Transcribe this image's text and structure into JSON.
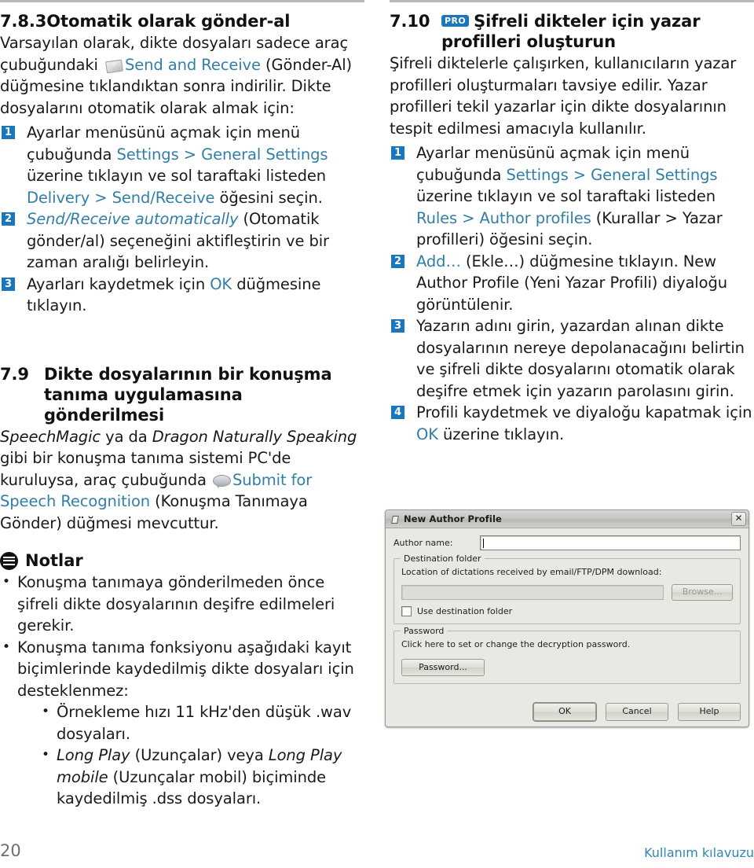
{
  "page": {
    "number": "20",
    "doc_label": "Kullanım kılavuzu"
  },
  "left_column": {
    "section": {
      "number": "7.8.3",
      "title": "Otomatik olarak gönder-al"
    },
    "intro": {
      "part1": "Varsayılan olarak, dikte dosyaları sadece araç çubuğundaki ",
      "icon": "send-receive-envelope-icon",
      "link": "Send and Receive",
      "part2": " (Gönder-Al) düğmesine tıklandıktan sonra indirilir. Dikte dosyalarını otomatik olarak almak için:"
    },
    "steps": [
      {
        "num": "1",
        "parts": [
          {
            "t": "Ayarlar menüsünü açmak için menü çubuğunda ",
            "s": "plain"
          },
          {
            "t": "Settings > General Settings",
            "s": "link"
          },
          {
            "t": " üzerine tıklayın ve sol taraftaki listeden ",
            "s": "plain"
          },
          {
            "t": "Delivery > Send/Receive",
            "s": "link"
          },
          {
            "t": " öğesini seçin.",
            "s": "plain"
          }
        ]
      },
      {
        "num": "2",
        "parts": [
          {
            "t": "Send/Receive automatically",
            "s": "link-italic"
          },
          {
            "t": " (Otomatik gönder/al) seçeneğini aktifleştirin ve bir zaman aralığı belirleyin.",
            "s": "plain"
          }
        ]
      },
      {
        "num": "3",
        "parts": [
          {
            "t": "Ayarları kaydetmek için ",
            "s": "plain"
          },
          {
            "t": "OK",
            "s": "link"
          },
          {
            "t": " düğmesine tıklayın.",
            "s": "plain"
          }
        ]
      }
    ],
    "section2": {
      "number": "7.9",
      "title": "Dikte dosyalarının bir konuşma tanıma uygulamasına gönderilmesi"
    },
    "para2": {
      "a": "SpeechMagic",
      "b": " ya da ",
      "c": "Dragon Naturally Speaking",
      "d": " gibi bir konuşma tanıma sistemi PC'de kuruluysa, araç çubuğunda ",
      "icon": "speech-bubble-icon",
      "e": "Submit for Speech Recognition",
      "f": " (Konuşma Tanımaya Gönder) düğmesi mevcuttur."
    },
    "notes": {
      "icon": "notes-icon",
      "label": "Notlar",
      "items": [
        "Konuşma tanımaya gönderilmeden önce şifreli dikte dosyalarının deşifre edilmeleri gerekir.",
        "Konuşma tanıma fonksiyonu aşağıdaki kayıt biçimlerinde kaydedilmiş dikte dosyaları için desteklenmez:"
      ],
      "sub_items": [
        {
          "parts": [
            {
              "t": "Örnekleme hızı 11 kHz'den düşük .wav dosyaları.",
              "s": "plain"
            }
          ]
        },
        {
          "parts": [
            {
              "t": "Long Play",
              "s": "italic"
            },
            {
              "t": " (Uzunçalar) veya ",
              "s": "plain"
            },
            {
              "t": "Long Play mobile",
              "s": "italic"
            },
            {
              "t": " (Uzunçalar mobil) biçiminde kaydedilmiş .dss dosyaları.",
              "s": "plain"
            }
          ]
        }
      ]
    }
  },
  "right_column": {
    "section": {
      "number": "7.10",
      "badge": "PRO",
      "title": "Şifreli dikteler için yazar profilleri oluşturun"
    },
    "intro": "Şifreli diktelerle çalışırken, kullanıcıların yazar profilleri oluşturmaları tavsiye edilir. Yazar profilleri tekil yazarlar için dikte dosyalarının tespit edilmesi amacıyla kullanılır.",
    "steps": [
      {
        "num": "1",
        "parts": [
          {
            "t": "Ayarlar menüsünü açmak için menü çubuğunda ",
            "s": "plain"
          },
          {
            "t": "Settings > General Settings",
            "s": "link"
          },
          {
            "t": " üzerine tıklayın ve sol taraftaki listeden ",
            "s": "plain"
          },
          {
            "t": "Rules > Author profiles",
            "s": "link"
          },
          {
            "t": " (Kurallar > Yazar profilleri) öğesini seçin.",
            "s": "plain"
          }
        ]
      },
      {
        "num": "2",
        "parts": [
          {
            "t": "Add…",
            "s": "link"
          },
          {
            "t": " (Ekle…) düğmesine tıklayın. New Author Profile (Yeni Yazar Profili) diyaloğu görüntülenir.",
            "s": "plain"
          }
        ]
      },
      {
        "num": "3",
        "parts": [
          {
            "t": "Yazarın adını girin, yazardan alınan dikte dosyalarının nereye depolanacağını belirtin ve şifreli dikte dosyalarını otomatik olarak deşifre etmek için yazarın parolasını girin.",
            "s": "plain"
          }
        ]
      },
      {
        "num": "4",
        "parts": [
          {
            "t": "Profili kaydetmek ve diyaloğu kapatmak için ",
            "s": "plain"
          },
          {
            "t": "OK",
            "s": "link"
          },
          {
            "t": " üzerine tıklayın.",
            "s": "plain"
          }
        ]
      }
    ],
    "dialog": {
      "title": "New Author Profile",
      "close": "✕",
      "author_label": "Author name:",
      "author_value": "",
      "destination_legend": "Destination folder",
      "destination_hint": "Location of dictations received by email/FTP/DPM download:",
      "path_value": "",
      "browse_label": "Browse...",
      "use_destination_label": "Use destination folder",
      "password_legend": "Password",
      "password_hint": "Click here to set or change the decryption password.",
      "password_button": "Password...",
      "ok_label": "OK",
      "cancel_label": "Cancel",
      "help_label": "Help"
    }
  },
  "colors": {
    "link": "#327fa6",
    "badge": "#1a77be",
    "rule": "#b9b9b9",
    "footer_doc": "#2f87b4"
  }
}
